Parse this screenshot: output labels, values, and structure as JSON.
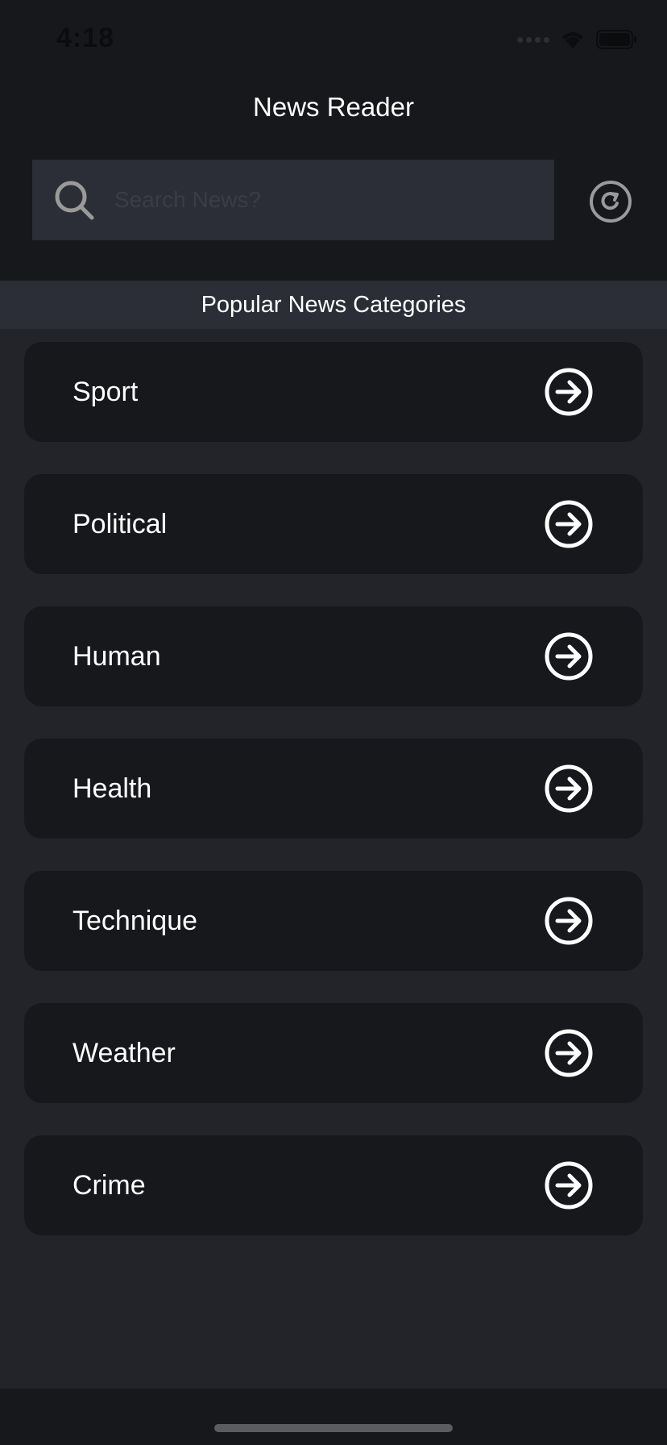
{
  "status_bar": {
    "time": "4:18"
  },
  "header": {
    "title": "News Reader"
  },
  "search": {
    "placeholder": "Search News?",
    "value": "",
    "icon": "search-icon"
  },
  "refresh": {
    "icon": "refresh-icon"
  },
  "section": {
    "title": "Popular News Categories"
  },
  "categories": [
    {
      "label": "Sport",
      "icon": "arrow-right-circle-icon"
    },
    {
      "label": "Political",
      "icon": "arrow-right-circle-icon"
    },
    {
      "label": "Human",
      "icon": "arrow-right-circle-icon"
    },
    {
      "label": "Health",
      "icon": "arrow-right-circle-icon"
    },
    {
      "label": "Technique",
      "icon": "arrow-right-circle-icon"
    },
    {
      "label": "Weather",
      "icon": "arrow-right-circle-icon"
    },
    {
      "label": "Crime",
      "icon": "arrow-right-circle-icon"
    }
  ],
  "colors": {
    "background": "#232429",
    "header_background": "#16181b",
    "card_background": "#16181b",
    "search_background": "#2b2e36",
    "text": "#ffffff",
    "icon_muted": "#9a9a9a"
  }
}
